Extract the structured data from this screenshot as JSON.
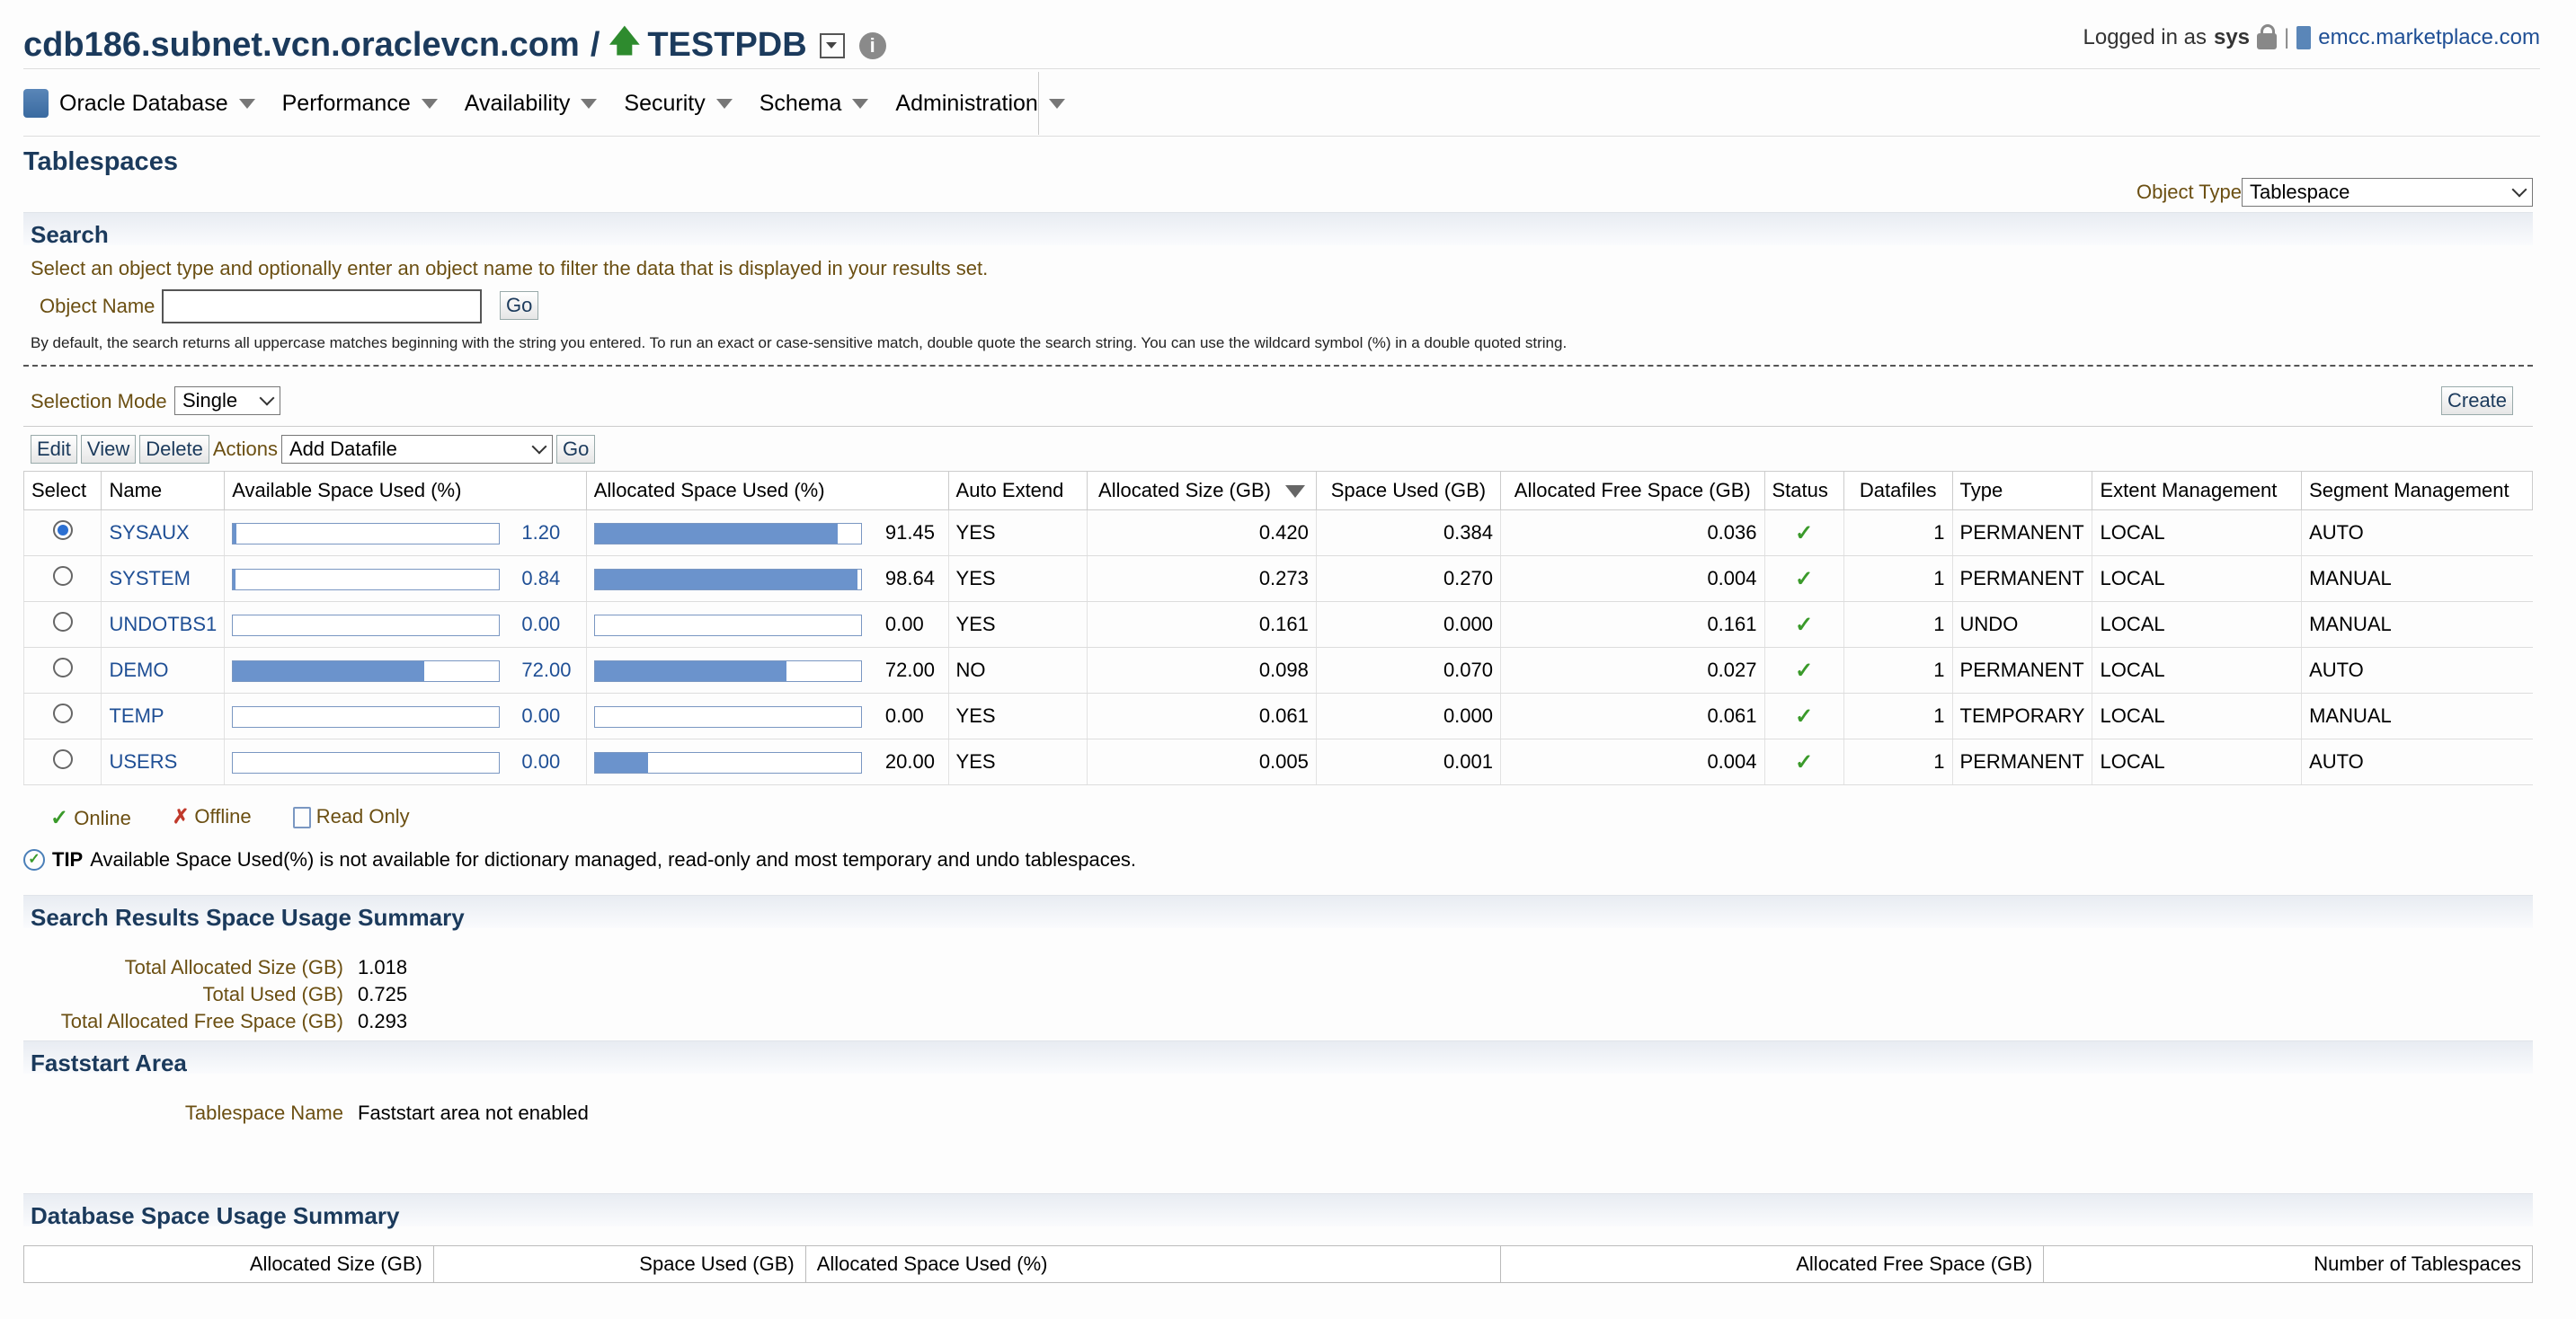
{
  "header": {
    "host": "cdb186.subnet.vcn.oraclevcn.com",
    "separator": "/",
    "target": "TESTPDB",
    "logged_in_label": "Logged in as",
    "user": "sys",
    "pipe": "|",
    "em_host": "emcc.marketplace.com"
  },
  "nav": {
    "items": [
      "Oracle Database",
      "Performance",
      "Availability",
      "Security",
      "Schema",
      "Administration"
    ]
  },
  "page": {
    "title": "Tablespaces",
    "object_type_label": "Object Type",
    "object_type_value": "Tablespace"
  },
  "search": {
    "title": "Search",
    "instruction": "Select an object type and optionally enter an object name to filter the data that is displayed in your results set.",
    "object_name_label": "Object Name",
    "object_name_value": "",
    "go_label": "Go",
    "hint": "By default, the search returns all uppercase matches beginning with the string you entered. To run an exact or case-sensitive match, double quote the search string. You can use the wildcard symbol (%) in a double quoted string."
  },
  "toolbar": {
    "selection_mode_label": "Selection Mode",
    "selection_mode_value": "Single",
    "create_label": "Create",
    "edit_label": "Edit",
    "view_label": "View",
    "delete_label": "Delete",
    "actions_label": "Actions",
    "actions_value": "Add Datafile",
    "go_label": "Go"
  },
  "table": {
    "columns": [
      "Select",
      "Name",
      "Available Space Used (%)",
      "Allocated Space Used (%)",
      "Auto Extend",
      "Allocated Size (GB)",
      "Space Used (GB)",
      "Allocated Free Space (GB)",
      "Status",
      "Datafiles",
      "Type",
      "Extent Management",
      "Segment Management"
    ],
    "rows": [
      {
        "selected": true,
        "name": "SYSAUX",
        "avail_pct": "1.20",
        "avail_frac": 0.012,
        "alloc_pct": "91.45",
        "alloc_frac": 0.9145,
        "auto_extend": "YES",
        "alloc_size": "0.420",
        "space_used": "0.384",
        "free_space": "0.036",
        "datafiles": "1",
        "type": "PERMANENT",
        "extent": "LOCAL",
        "segment": "AUTO"
      },
      {
        "selected": false,
        "name": "SYSTEM",
        "avail_pct": "0.84",
        "avail_frac": 0.0084,
        "alloc_pct": "98.64",
        "alloc_frac": 0.9864,
        "auto_extend": "YES",
        "alloc_size": "0.273",
        "space_used": "0.270",
        "free_space": "0.004",
        "datafiles": "1",
        "type": "PERMANENT",
        "extent": "LOCAL",
        "segment": "MANUAL"
      },
      {
        "selected": false,
        "name": "UNDOTBS1",
        "avail_pct": "0.00",
        "avail_frac": 0.0,
        "alloc_pct": "0.00",
        "alloc_frac": 0.0,
        "auto_extend": "YES",
        "alloc_size": "0.161",
        "space_used": "0.000",
        "free_space": "0.161",
        "datafiles": "1",
        "type": "UNDO",
        "extent": "LOCAL",
        "segment": "MANUAL"
      },
      {
        "selected": false,
        "name": "DEMO",
        "avail_pct": "72.00",
        "avail_frac": 0.72,
        "alloc_pct": "72.00",
        "alloc_frac": 0.72,
        "auto_extend": "NO",
        "alloc_size": "0.098",
        "space_used": "0.070",
        "free_space": "0.027",
        "datafiles": "1",
        "type": "PERMANENT",
        "extent": "LOCAL",
        "segment": "AUTO"
      },
      {
        "selected": false,
        "name": "TEMP",
        "avail_pct": "0.00",
        "avail_frac": 0.0,
        "alloc_pct": "0.00",
        "alloc_frac": 0.0,
        "auto_extend": "YES",
        "alloc_size": "0.061",
        "space_used": "0.000",
        "free_space": "0.061",
        "datafiles": "1",
        "type": "TEMPORARY",
        "extent": "LOCAL",
        "segment": "MANUAL"
      },
      {
        "selected": false,
        "name": "USERS",
        "avail_pct": "0.00",
        "avail_frac": 0.0,
        "alloc_pct": "20.00",
        "alloc_frac": 0.2,
        "auto_extend": "YES",
        "alloc_size": "0.005",
        "space_used": "0.001",
        "free_space": "0.004",
        "datafiles": "1",
        "type": "PERMANENT",
        "extent": "LOCAL",
        "segment": "AUTO"
      }
    ]
  },
  "legend": {
    "online": "Online",
    "offline": "Offline",
    "read_only": "Read Only"
  },
  "tip": {
    "label": "TIP",
    "text": "Available Space Used(%) is not available for dictionary managed, read-only and most temporary and undo tablespaces."
  },
  "results_summary": {
    "title": "Search Results Space Usage Summary",
    "total_alloc_label": "Total Allocated Size (GB)",
    "total_alloc_value": "1.018",
    "total_used_label": "Total Used (GB)",
    "total_used_value": "0.725",
    "total_free_label": "Total Allocated Free Space (GB)",
    "total_free_value": "0.293"
  },
  "faststart": {
    "title": "Faststart Area",
    "tablespace_name_label": "Tablespace Name",
    "tablespace_name_value": "Faststart area not enabled"
  },
  "db_summary": {
    "title": "Database Space Usage Summary",
    "columns": [
      "Allocated Size (GB)",
      "Space Used (GB)",
      "Allocated Space Used (%)",
      "Allocated Free Space (GB)",
      "Number of Tablespaces"
    ]
  },
  "colors": {
    "accent": "#1b3a5c",
    "bar_fill": "#6b93cc",
    "label_brown": "#6b4f12",
    "online_green": "#3a9a2a",
    "offline_red": "#c0392b"
  }
}
